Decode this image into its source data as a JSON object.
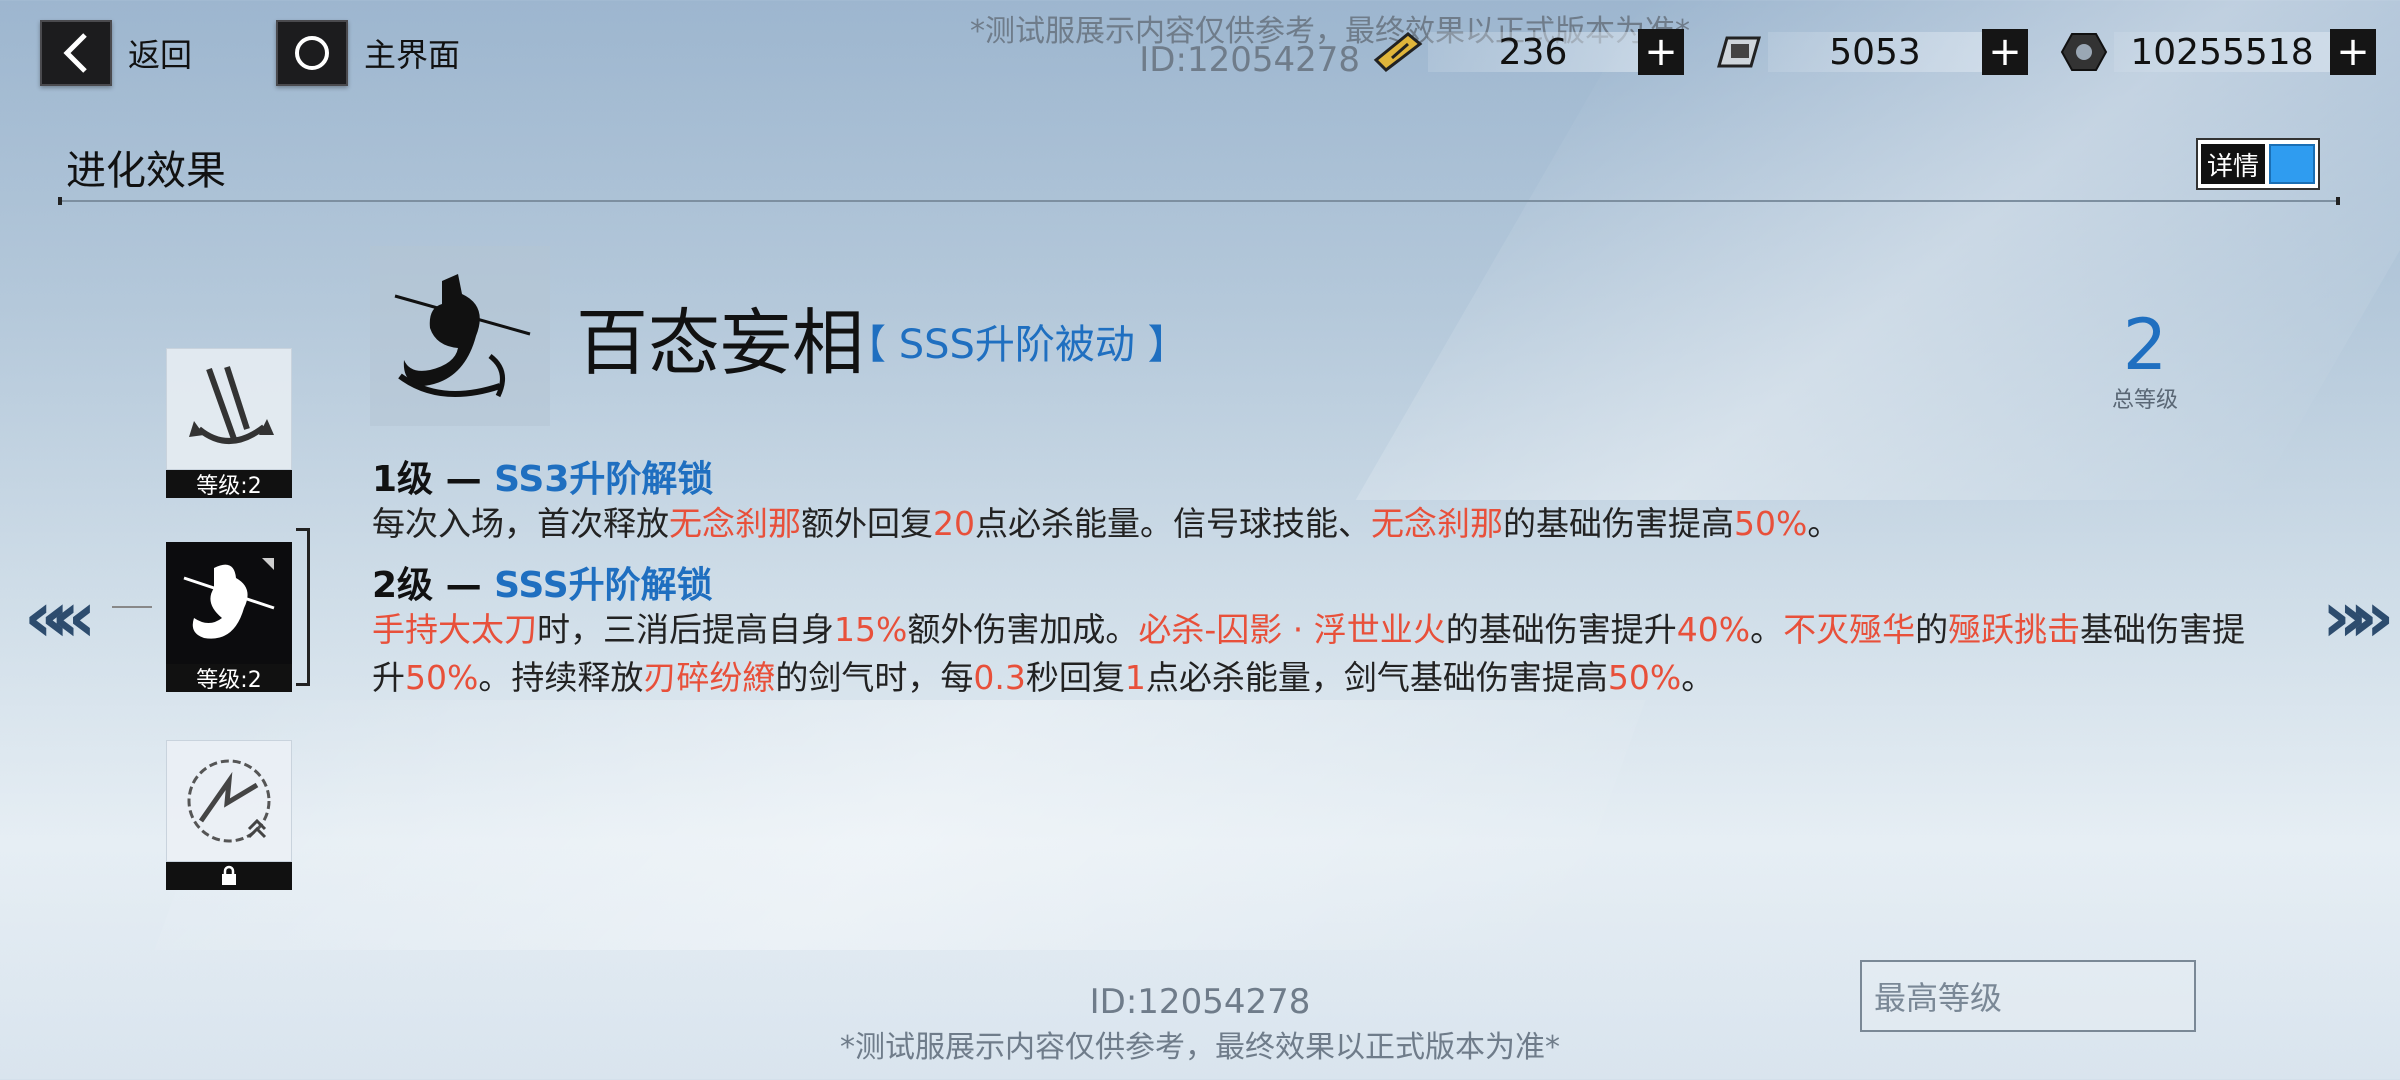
{
  "topbar": {
    "back_label": "返回",
    "home_label": "主界面",
    "watermark_note": "*测试服展示内容仅供参考，最终效果以正式版本为准*",
    "watermark_id": "ID:12054278",
    "currencies": [
      {
        "icon": "ticket-icon",
        "value": "236"
      },
      {
        "icon": "chip-icon",
        "value": "5053"
      },
      {
        "icon": "hex-nut-icon",
        "value": "10255518"
      }
    ]
  },
  "header": {
    "title": "进化效果",
    "detail_toggle_label": "详情"
  },
  "skill_list": [
    {
      "icon": "anchor-weapon-icon",
      "level_label": "等级:2"
    },
    {
      "icon": "swordswoman-icon",
      "level_label": "等级:2"
    },
    {
      "icon": "circle-sigil-icon",
      "level_label": "lock-icon"
    }
  ],
  "skill": {
    "name": "百态妄相",
    "tag": "【 SSS升阶被动 】",
    "total_level": "2",
    "total_level_caption": "总等级",
    "levels": [
      {
        "prefix": "1级 — ",
        "unlock": "SS3升阶解锁",
        "desc": [
          {
            "t": "每次入场，首次释放"
          },
          {
            "t": "无念刹那",
            "h": true
          },
          {
            "t": "额外回复"
          },
          {
            "t": "20",
            "h": true
          },
          {
            "t": "点必杀能量。信号球技能、"
          },
          {
            "t": "无念刹那",
            "h": true
          },
          {
            "t": "的基础伤害提高"
          },
          {
            "t": "50%",
            "h": true
          },
          {
            "t": "。"
          }
        ]
      },
      {
        "prefix": "2级 — ",
        "unlock": "SSS升阶解锁",
        "desc": [
          {
            "t": "手持大太刀",
            "h": true
          },
          {
            "t": "时，三消后提高自身"
          },
          {
            "t": "15%",
            "h": true
          },
          {
            "t": "额外伤害加成。"
          },
          {
            "t": "必杀-囚影 · 浮世业火",
            "h": true
          },
          {
            "t": "的基础伤害提升"
          },
          {
            "t": "40%",
            "h": true
          },
          {
            "t": "。"
          },
          {
            "t": "不灭殛华",
            "h": true
          },
          {
            "t": "的"
          },
          {
            "t": "殛跃挑击",
            "h": true
          },
          {
            "t": "基础伤害提升"
          },
          {
            "t": "50%",
            "h": true
          },
          {
            "t": "。持续释放"
          },
          {
            "t": "刃碎纷繚",
            "h": true
          },
          {
            "t": "的剑气时，每"
          },
          {
            "t": "0.3",
            "h": true
          },
          {
            "t": "秒回复"
          },
          {
            "t": "1",
            "h": true
          },
          {
            "t": "点必杀能量，剑气基础伤害提高"
          },
          {
            "t": "50%",
            "h": true
          },
          {
            "t": "。"
          }
        ]
      }
    ]
  },
  "footer": {
    "max_level_label": "最高等级"
  },
  "colors": {
    "accent_blue": "#1f6fc0",
    "highlight_red": "#e8503a",
    "toggle_on": "#2f9cf0"
  }
}
